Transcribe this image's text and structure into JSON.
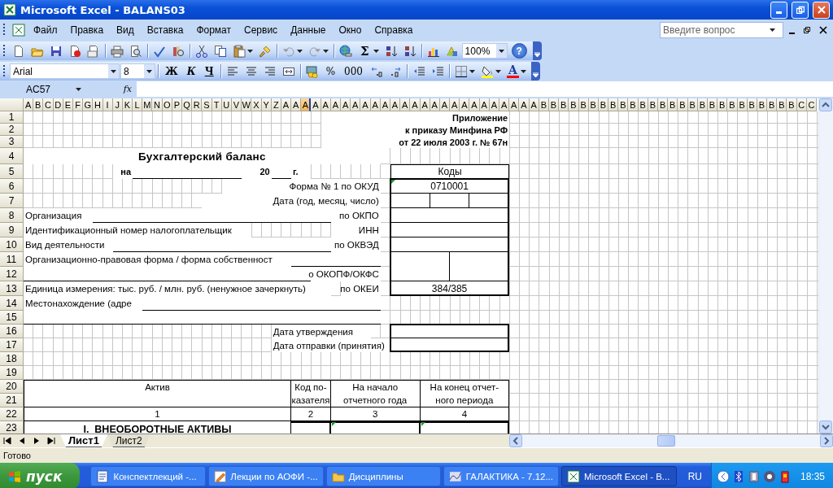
{
  "window": {
    "title": "Microsoft Excel - BALANS03"
  },
  "menu": [
    "Файл",
    "Правка",
    "Вид",
    "Вставка",
    "Формат",
    "Сервис",
    "Данные",
    "Окно",
    "Справка"
  ],
  "help_search": {
    "placeholder": "Введите вопрос"
  },
  "standard_toolbar": {
    "autosum": "Σ",
    "zoom": "100%",
    "help": "?"
  },
  "formatting_toolbar": {
    "font": "Arial",
    "size": "8",
    "style_buttons": [
      "Ж",
      "К",
      "Ч"
    ],
    "percent": "%",
    "thousands": "000",
    "font_color": "A"
  },
  "formula_bar": {
    "name_box": "AC57",
    "function_label": "fx"
  },
  "column_headers": [
    {
      "label": "A",
      "selected": false
    },
    {
      "label": "B",
      "selected": false
    },
    {
      "label": "C",
      "selected": false
    },
    {
      "label": "D",
      "selected": false
    },
    {
      "label": "E",
      "selected": false
    },
    {
      "label": "F",
      "selected": false
    },
    {
      "label": "G",
      "selected": false
    },
    {
      "label": "H",
      "selected": false
    },
    {
      "label": "I",
      "selected": false
    },
    {
      "label": "J",
      "selected": false
    },
    {
      "label": "K",
      "selected": false
    },
    {
      "label": "L",
      "selected": false
    },
    {
      "label": "M",
      "selected": false
    },
    {
      "label": "N",
      "selected": false
    },
    {
      "label": "O",
      "selected": false
    },
    {
      "label": "P",
      "selected": false
    },
    {
      "label": "Q",
      "selected": false
    },
    {
      "label": "R",
      "selected": false
    },
    {
      "label": "S",
      "selected": false
    },
    {
      "label": "T",
      "selected": false
    },
    {
      "label": "U",
      "selected": false
    },
    {
      "label": "V",
      "selected": false
    },
    {
      "label": "W",
      "selected": false
    },
    {
      "label": "X",
      "selected": false
    },
    {
      "label": "Y",
      "selected": false
    },
    {
      "label": "Z",
      "selected": false
    },
    {
      "label": "A",
      "selected": false
    },
    {
      "label": "A",
      "selected": false
    },
    {
      "label": "A",
      "selected": true
    },
    {
      "label": "A",
      "selected": false
    },
    {
      "label": "A",
      "selected": false
    },
    {
      "label": "A",
      "selected": false
    },
    {
      "label": "A",
      "selected": false
    },
    {
      "label": "A",
      "selected": false
    },
    {
      "label": "A",
      "selected": false
    },
    {
      "label": "A",
      "selected": false
    },
    {
      "label": "A",
      "selected": false
    },
    {
      "label": "A",
      "selected": false
    },
    {
      "label": "A",
      "selected": false
    },
    {
      "label": "A",
      "selected": false
    },
    {
      "label": "A",
      "selected": false
    },
    {
      "label": "A",
      "selected": false
    },
    {
      "label": "A",
      "selected": false
    },
    {
      "label": "A",
      "selected": false
    },
    {
      "label": "A",
      "selected": false
    },
    {
      "label": "A",
      "selected": false
    },
    {
      "label": "A",
      "selected": false
    },
    {
      "label": "A",
      "selected": false
    },
    {
      "label": "A",
      "selected": false
    },
    {
      "label": "A",
      "selected": false
    },
    {
      "label": "A",
      "selected": false
    },
    {
      "label": "A",
      "selected": false
    },
    {
      "label": "B",
      "selected": false
    },
    {
      "label": "B",
      "selected": false
    },
    {
      "label": "B",
      "selected": false
    },
    {
      "label": "B",
      "selected": false
    },
    {
      "label": "B",
      "selected": false
    },
    {
      "label": "B",
      "selected": false
    },
    {
      "label": "B",
      "selected": false
    },
    {
      "label": "B",
      "selected": false
    },
    {
      "label": "B",
      "selected": false
    },
    {
      "label": "B",
      "selected": false
    },
    {
      "label": "B",
      "selected": false
    },
    {
      "label": "B",
      "selected": false
    },
    {
      "label": "B",
      "selected": false
    },
    {
      "label": "B",
      "selected": false
    },
    {
      "label": "B",
      "selected": false
    },
    {
      "label": "B",
      "selected": false
    },
    {
      "label": "B",
      "selected": false
    },
    {
      "label": "B",
      "selected": false
    },
    {
      "label": "B",
      "selected": false
    },
    {
      "label": "B",
      "selected": false
    },
    {
      "label": "B",
      "selected": false
    },
    {
      "label": "B",
      "selected": false
    },
    {
      "label": "B",
      "selected": false
    },
    {
      "label": "B",
      "selected": false
    },
    {
      "label": "B",
      "selected": false
    },
    {
      "label": "B",
      "selected": false
    },
    {
      "label": "C",
      "selected": false
    },
    {
      "label": "C",
      "selected": false
    }
  ],
  "row_headers": [
    "1",
    "2",
    "3",
    "4",
    "5",
    "6",
    "7",
    "8",
    "9",
    "10",
    "11",
    "12",
    "13",
    "14",
    "15",
    "16",
    "17",
    "18",
    "19",
    "20",
    "21",
    "22",
    "23"
  ],
  "labels": [
    "Приложение",
    "к приказу Минфина РФ",
    "от 22 июля 2003 г. № 67н",
    "Бухгалтерский баланс",
    "на",
    "20",
    "г.",
    "Форма № 1 по ОКУД",
    "Дата (год, месяц, число)",
    "Организация",
    "по ОКПО",
    "Идентификационный номер налогоплательщик",
    "ИНН",
    "Вид деятельности",
    "по ОКВЭД",
    "Организационно-правовая форма / форма собственност",
    "о ОКОПФ/ОКФС",
    "Единица измерения: тыс. руб. / млн. руб. (ненужное зачеркнуть)",
    "по ОКЕИ",
    "Местонахождение (адре",
    "Дата утверждения",
    "Дата отправки (принятия)"
  ],
  "codes": [
    "Коды",
    "0710001",
    "384/385"
  ],
  "table": {
    "columns": [
      "Актив",
      "Код по-\nказателя",
      "На начало\nотчетного года",
      "На конец отчет-\nного периода"
    ],
    "numbers": [
      "1",
      "2",
      "3",
      "4"
    ],
    "section": "I.  ВНЕОБОРОТНЫЕ АКТИВЫ"
  },
  "sheet_tabs": [
    {
      "label": "Лист1",
      "selected": true
    },
    {
      "label": "Лист2",
      "selected": false
    }
  ],
  "status_bar": "Готово",
  "taskbar": {
    "start": "пуск",
    "tasks": [
      {
        "label": "Конспектлекций -...",
        "selected": false
      },
      {
        "label": "Лекции по АОФИ -...",
        "selected": false
      },
      {
        "label": "Дисциплины",
        "selected": false
      },
      {
        "label": "ГАЛАКТИКА - 7.12...",
        "selected": false
      },
      {
        "label": "Microsoft Excel - B...",
        "selected": true
      }
    ],
    "language": "RU",
    "clock": "18:35"
  }
}
